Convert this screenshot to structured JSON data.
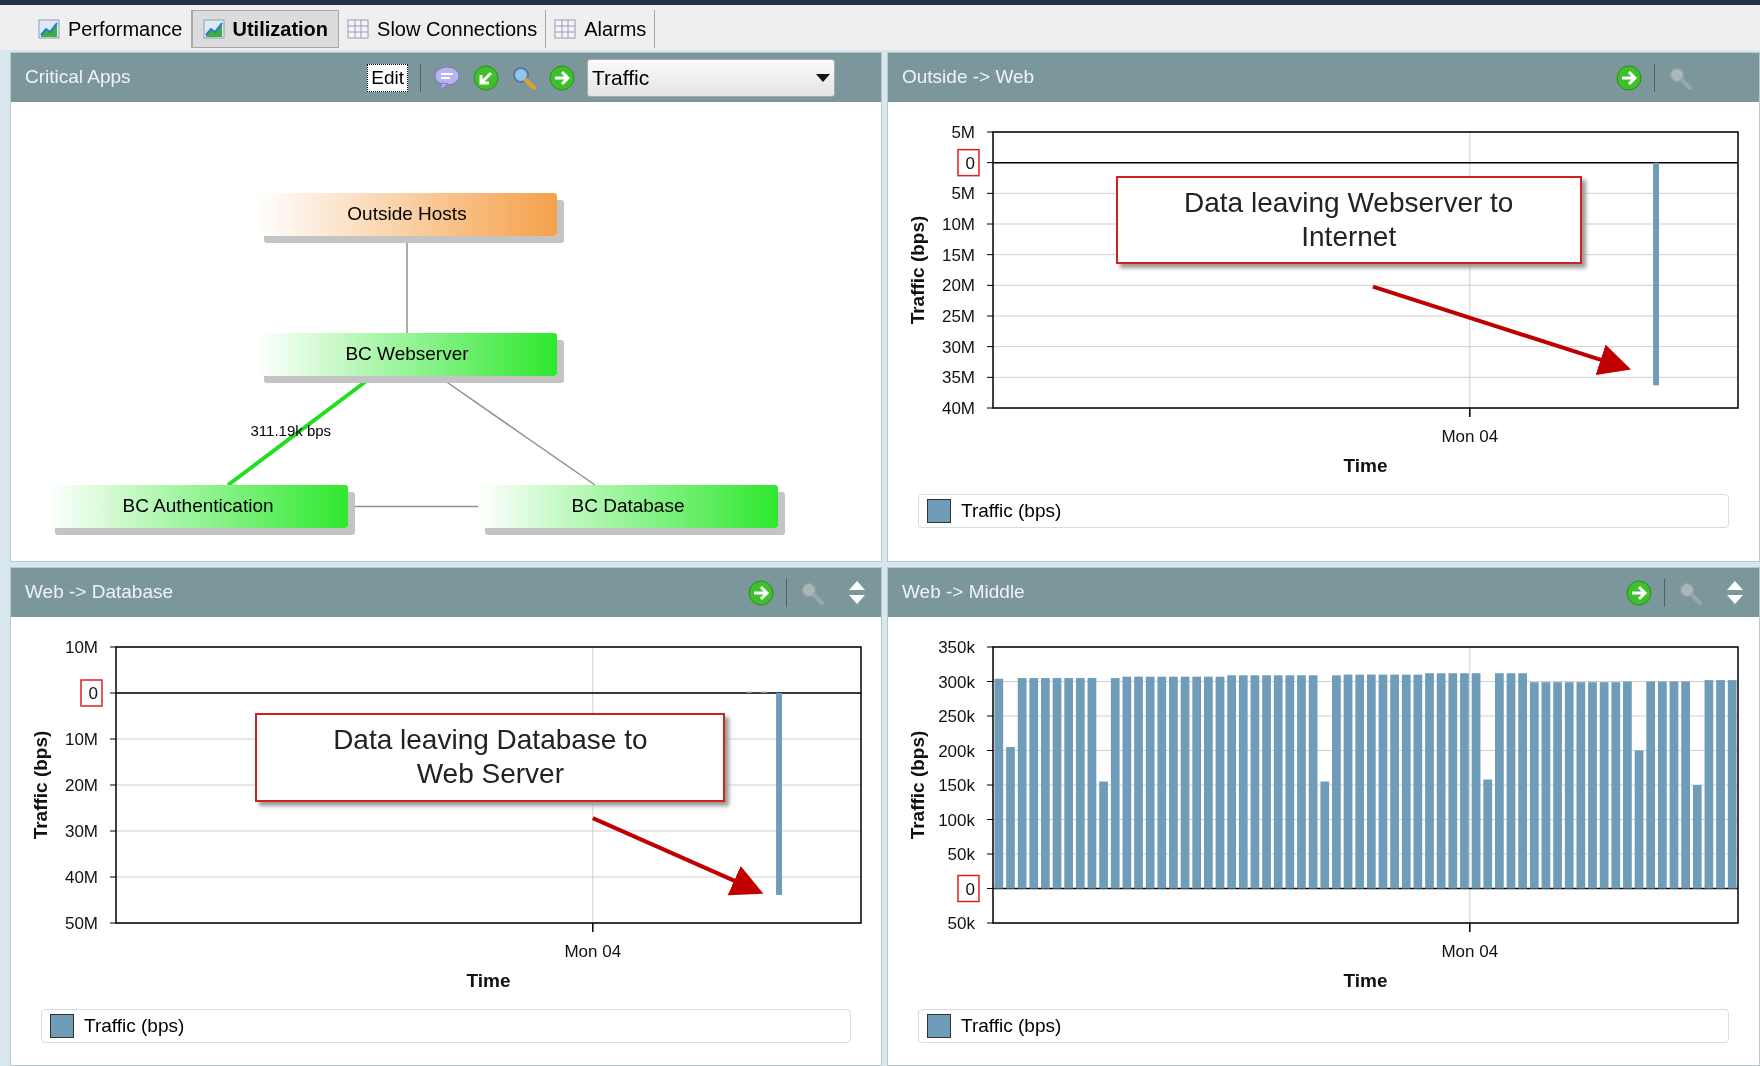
{
  "tabs": [
    {
      "label": "Performance",
      "kind": "chart",
      "selected": false
    },
    {
      "label": "Utilization",
      "kind": "chart",
      "selected": true
    },
    {
      "label": "Slow Connections",
      "kind": "table",
      "selected": false
    },
    {
      "label": "Alarms",
      "kind": "table",
      "selected": false
    }
  ],
  "panels": [
    {
      "title": "Critical Apps",
      "kind": "diagram",
      "edit_label": "Edit",
      "dropdown": "Traffic",
      "nodes": [
        {
          "label": "Outside Hosts",
          "color": "#f5a04a"
        },
        {
          "label": "BC Webserver",
          "color": "#2ee82e"
        },
        {
          "label": "BC Authentication",
          "color": "#2ee82e"
        },
        {
          "label": "BC Database",
          "color": "#2ee82e"
        }
      ],
      "edges": [
        {
          "active": false
        },
        {
          "active": true,
          "label": "311.19k bps"
        },
        {
          "active": false
        },
        {
          "active": false
        }
      ]
    },
    {
      "title": "Outside -> Web",
      "kind": "chart",
      "zoom_disabled": true,
      "reorder": false,
      "callout": "Data leaving Webserver to Internet",
      "chart_data": {
        "type": "bar",
        "grid": true,
        "xlabel": "Time",
        "ylabel": "Traffic (bps)",
        "ylim": [
          -40000000,
          5000000
        ],
        "yticks": [
          {
            "value": 5000000,
            "label": "5M"
          },
          {
            "value": 0,
            "label": "0"
          },
          {
            "value": -5000000,
            "label": "5M"
          },
          {
            "value": -10000000,
            "label": "10M"
          },
          {
            "value": -15000000,
            "label": "15M"
          },
          {
            "value": -20000000,
            "label": "20M"
          },
          {
            "value": -25000000,
            "label": "25M"
          },
          {
            "value": -30000000,
            "label": "30M"
          },
          {
            "value": -35000000,
            "label": "35M"
          },
          {
            "value": -40000000,
            "label": "40M"
          }
        ],
        "series": [
          {
            "name": "Traffic (bps)",
            "color": "#6e9cb9",
            "values": [
              null,
              null,
              null,
              null,
              null,
              null,
              null,
              null,
              null,
              null,
              null,
              null,
              null,
              null,
              null,
              null,
              null,
              null,
              null,
              null,
              null,
              null,
              null,
              null,
              null,
              null,
              null,
              null,
              null,
              null,
              null,
              null,
              null,
              null,
              null,
              null,
              null,
              null,
              null,
              null,
              null,
              null,
              null,
              null,
              -36300000,
              null,
              null,
              null,
              null,
              null
            ]
          }
        ],
        "annotations": [
          {
            "text": "Mon 04"
          }
        ]
      }
    },
    {
      "title": "Web -> Database",
      "kind": "chart",
      "zoom_disabled": true,
      "reorder": true,
      "callout": "Data leaving Database to Web Server",
      "chart_data": {
        "type": "bar",
        "grid": true,
        "xlabel": "Time",
        "ylabel": "Traffic (bps)",
        "ylim": [
          -50000000,
          10000000
        ],
        "yticks": [
          {
            "value": 10000000,
            "label": "10M"
          },
          {
            "value": 0,
            "label": "0"
          },
          {
            "value": -10000000,
            "label": "10M"
          },
          {
            "value": -20000000,
            "label": "20M"
          },
          {
            "value": -30000000,
            "label": "30M"
          },
          {
            "value": -40000000,
            "label": "40M"
          },
          {
            "value": -50000000,
            "label": "50M"
          }
        ],
        "series": [
          {
            "name": "Traffic (bps)",
            "color": "#6e9cb9",
            "values": [
              null,
              null,
              null,
              null,
              null,
              null,
              null,
              null,
              null,
              null,
              null,
              null,
              null,
              null,
              null,
              null,
              null,
              null,
              null,
              null,
              null,
              null,
              null,
              null,
              null,
              null,
              null,
              null,
              null,
              null,
              null,
              null,
              null,
              null,
              null,
              null,
              null,
              null,
              null,
              null,
              null,
              null,
              300000,
              300000,
              -43900000,
              null,
              null,
              null,
              null,
              null
            ]
          }
        ],
        "annotations": [
          {
            "text": "Mon 04"
          }
        ]
      }
    },
    {
      "title": "Web -> Middle",
      "kind": "chart",
      "zoom_disabled": true,
      "reorder": true,
      "chart_data": {
        "type": "bar",
        "grid": true,
        "xlabel": "Time",
        "ylabel": "Traffic (bps)",
        "ylim": [
          -50000,
          350000
        ],
        "yticks": [
          {
            "value": 350000,
            "label": "350k"
          },
          {
            "value": 300000,
            "label": "300k"
          },
          {
            "value": 250000,
            "label": "250k"
          },
          {
            "value": 200000,
            "label": "200k"
          },
          {
            "value": 150000,
            "label": "150k"
          },
          {
            "value": 100000,
            "label": "100k"
          },
          {
            "value": 50000,
            "label": "50k"
          },
          {
            "value": 0,
            "label": "0"
          },
          {
            "value": -50000,
            "label": "50k"
          }
        ],
        "series": [
          {
            "name": "Traffic (bps)",
            "color": "#6e9cb9",
            "values": [
              304000,
              205000,
              305000,
              305000,
              305000,
              305000,
              305000,
              305000,
              305000,
              155000,
              305000,
              307000,
              307000,
              307000,
              307000,
              307000,
              307000,
              307000,
              307000,
              307000,
              309000,
              309000,
              309000,
              309000,
              309000,
              309000,
              309000,
              309000,
              155000,
              309000,
              310000,
              310000,
              310000,
              310000,
              310000,
              310000,
              310000,
              312000,
              312000,
              312000,
              312000,
              312000,
              158000,
              312000,
              312000,
              312000,
              299000,
              299000,
              299000,
              299000,
              299000,
              299000,
              299000,
              299000,
              300000,
              200000,
              300000,
              300000,
              300000,
              300000,
              150000,
              302000,
              302000,
              302000
            ]
          }
        ],
        "annotations": [
          {
            "text": "Mon 04"
          }
        ]
      }
    }
  ]
}
